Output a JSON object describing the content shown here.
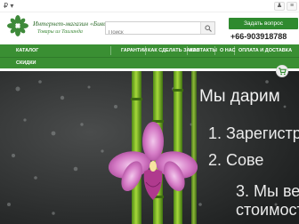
{
  "topbar": {
    "currency": "₽ ▾"
  },
  "logo": {
    "line1": "Интернет-магазин «Бивис»",
    "line2": "Товары из Таиланда"
  },
  "search": {
    "placeholder": "Поиск"
  },
  "header": {
    "ask_label": "Задать вопрос",
    "phone": "+66-903918788"
  },
  "nav": {
    "items": [
      {
        "label": "КАТАЛОГ"
      },
      {
        "label": "ГАРАНТИИ"
      },
      {
        "label": "КАК СДЕЛАТЬ ЗАКАЗ"
      },
      {
        "label": "КОНТАКТЫ"
      },
      {
        "label": "О НАС"
      },
      {
        "label": "ОПЛАТА И ДОСТАВКА"
      }
    ],
    "second_row": [
      {
        "label": "СКИДКИ"
      }
    ]
  },
  "banner": {
    "slogan": "Мы дарим",
    "steps": [
      "1. Зарегистр",
      "2. Сове",
      "3. Мы ве",
      "стоимост"
    ]
  },
  "colors": {
    "brand_green": "#3a8f33",
    "button_green": "#2f8a2f",
    "banner_dark": "#2b2d2d",
    "orchid_pink": "#c85fb4"
  }
}
